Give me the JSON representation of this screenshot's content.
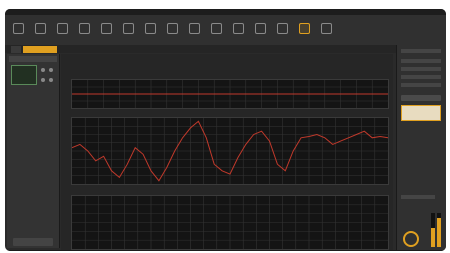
{
  "app": {
    "accent": "#e0a020",
    "background": "#2a2a2a"
  },
  "ribbon": {
    "buttons": [
      {
        "icon": "toolbar-icon"
      },
      {
        "icon": "toolbar-icon"
      },
      {
        "icon": "toolbar-icon"
      },
      {
        "icon": "toolbar-icon"
      },
      {
        "icon": "toolbar-icon"
      },
      {
        "icon": "toolbar-icon"
      },
      {
        "icon": "toolbar-icon"
      },
      {
        "icon": "toolbar-icon"
      },
      {
        "icon": "toolbar-icon"
      },
      {
        "icon": "toolbar-icon"
      },
      {
        "icon": "toolbar-icon"
      },
      {
        "icon": "toolbar-icon"
      },
      {
        "icon": "toolbar-icon"
      },
      {
        "icon": "toolbar-icon"
      },
      {
        "icon": "toolbar-icon"
      }
    ]
  },
  "charts": {
    "top_color": "#c0392b",
    "middle_color": "#c0392b"
  },
  "chart_data": [
    {
      "type": "line",
      "title": "",
      "x": [
        1,
        2,
        3,
        4,
        5,
        6,
        7,
        8,
        9,
        10
      ],
      "series": [
        {
          "values": [
            0.5,
            0.5,
            0.5,
            0.5,
            0.5,
            0.5,
            0.5,
            0.5,
            0.5,
            0.5
          ]
        }
      ],
      "ylim": [
        0,
        1
      ]
    },
    {
      "type": "line",
      "title": "",
      "x": [
        0,
        1,
        2,
        3,
        4,
        5,
        6,
        7,
        8,
        9,
        10,
        11,
        12,
        13,
        14,
        15,
        16,
        17,
        18,
        19,
        20,
        21,
        22,
        23,
        24,
        25,
        26,
        27,
        28,
        29,
        30,
        31,
        32,
        33,
        34,
        35,
        36,
        37,
        38,
        39,
        40
      ],
      "series": [
        {
          "values": [
            0.55,
            0.6,
            0.5,
            0.35,
            0.42,
            0.2,
            0.1,
            0.3,
            0.55,
            0.45,
            0.2,
            0.05,
            0.25,
            0.5,
            0.7,
            0.85,
            0.95,
            0.7,
            0.3,
            0.2,
            0.15,
            0.4,
            0.6,
            0.75,
            0.8,
            0.65,
            0.3,
            0.2,
            0.5,
            0.7,
            0.72,
            0.75,
            0.7,
            0.6,
            0.65,
            0.7,
            0.75,
            0.8,
            0.7,
            0.72,
            0.7
          ]
        }
      ],
      "ylim": [
        0,
        1
      ]
    },
    {
      "type": "line",
      "title": "",
      "x": [],
      "series": [],
      "ylim": [
        0,
        1
      ]
    }
  ],
  "meters": {
    "left_level": 0.55,
    "right_level": 0.85
  }
}
